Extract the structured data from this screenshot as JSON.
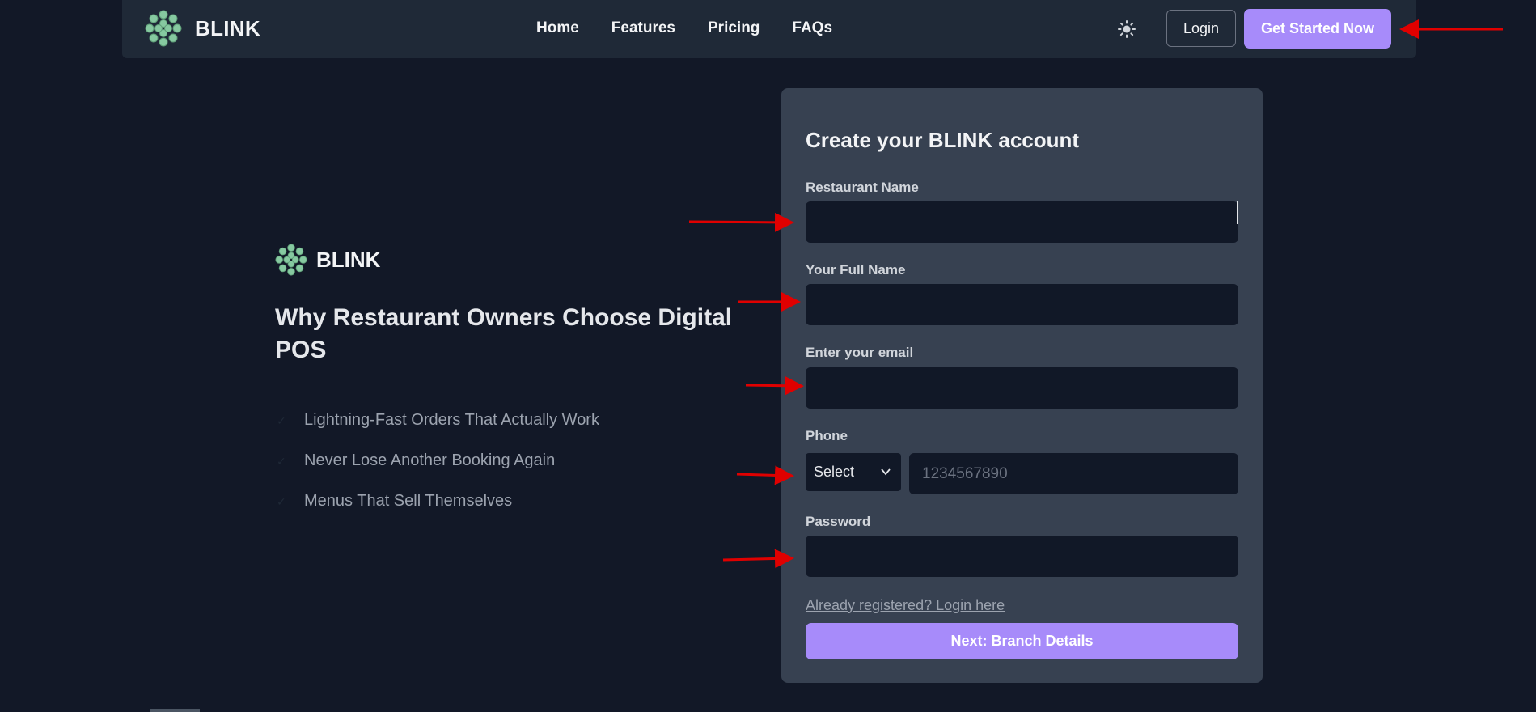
{
  "header": {
    "brand": "BLINK",
    "nav": [
      "Home",
      "Features",
      "Pricing",
      "FAQs"
    ],
    "login_label": "Login",
    "cta_label": "Get Started Now",
    "theme_icon": "sun-icon"
  },
  "left": {
    "brand": "BLINK",
    "headline": "Why Restaurant Owners Choose Digital POS",
    "benefits": [
      "Lightning-Fast Orders That Actually Work",
      "Never Lose Another Booking Again",
      "Menus That Sell Themselves"
    ]
  },
  "form": {
    "title": "Create your BLINK account",
    "restaurant_name": {
      "label": "Restaurant Name",
      "value": ""
    },
    "full_name": {
      "label": "Your Full Name",
      "value": ""
    },
    "email": {
      "label": "Enter your email",
      "value": ""
    },
    "phone": {
      "label": "Phone",
      "country_select": "Select",
      "placeholder": "1234567890"
    },
    "password": {
      "label": "Password",
      "value": ""
    },
    "login_link": "Already registered? Login here",
    "submit_label": "Next: Branch Details"
  },
  "colors": {
    "background": "#121827",
    "navbar": "#1f2937",
    "card": "#374151",
    "input": "#111827",
    "accent": "#a78bfa",
    "annotation": "#e00000",
    "logo": "#86c9a0"
  }
}
